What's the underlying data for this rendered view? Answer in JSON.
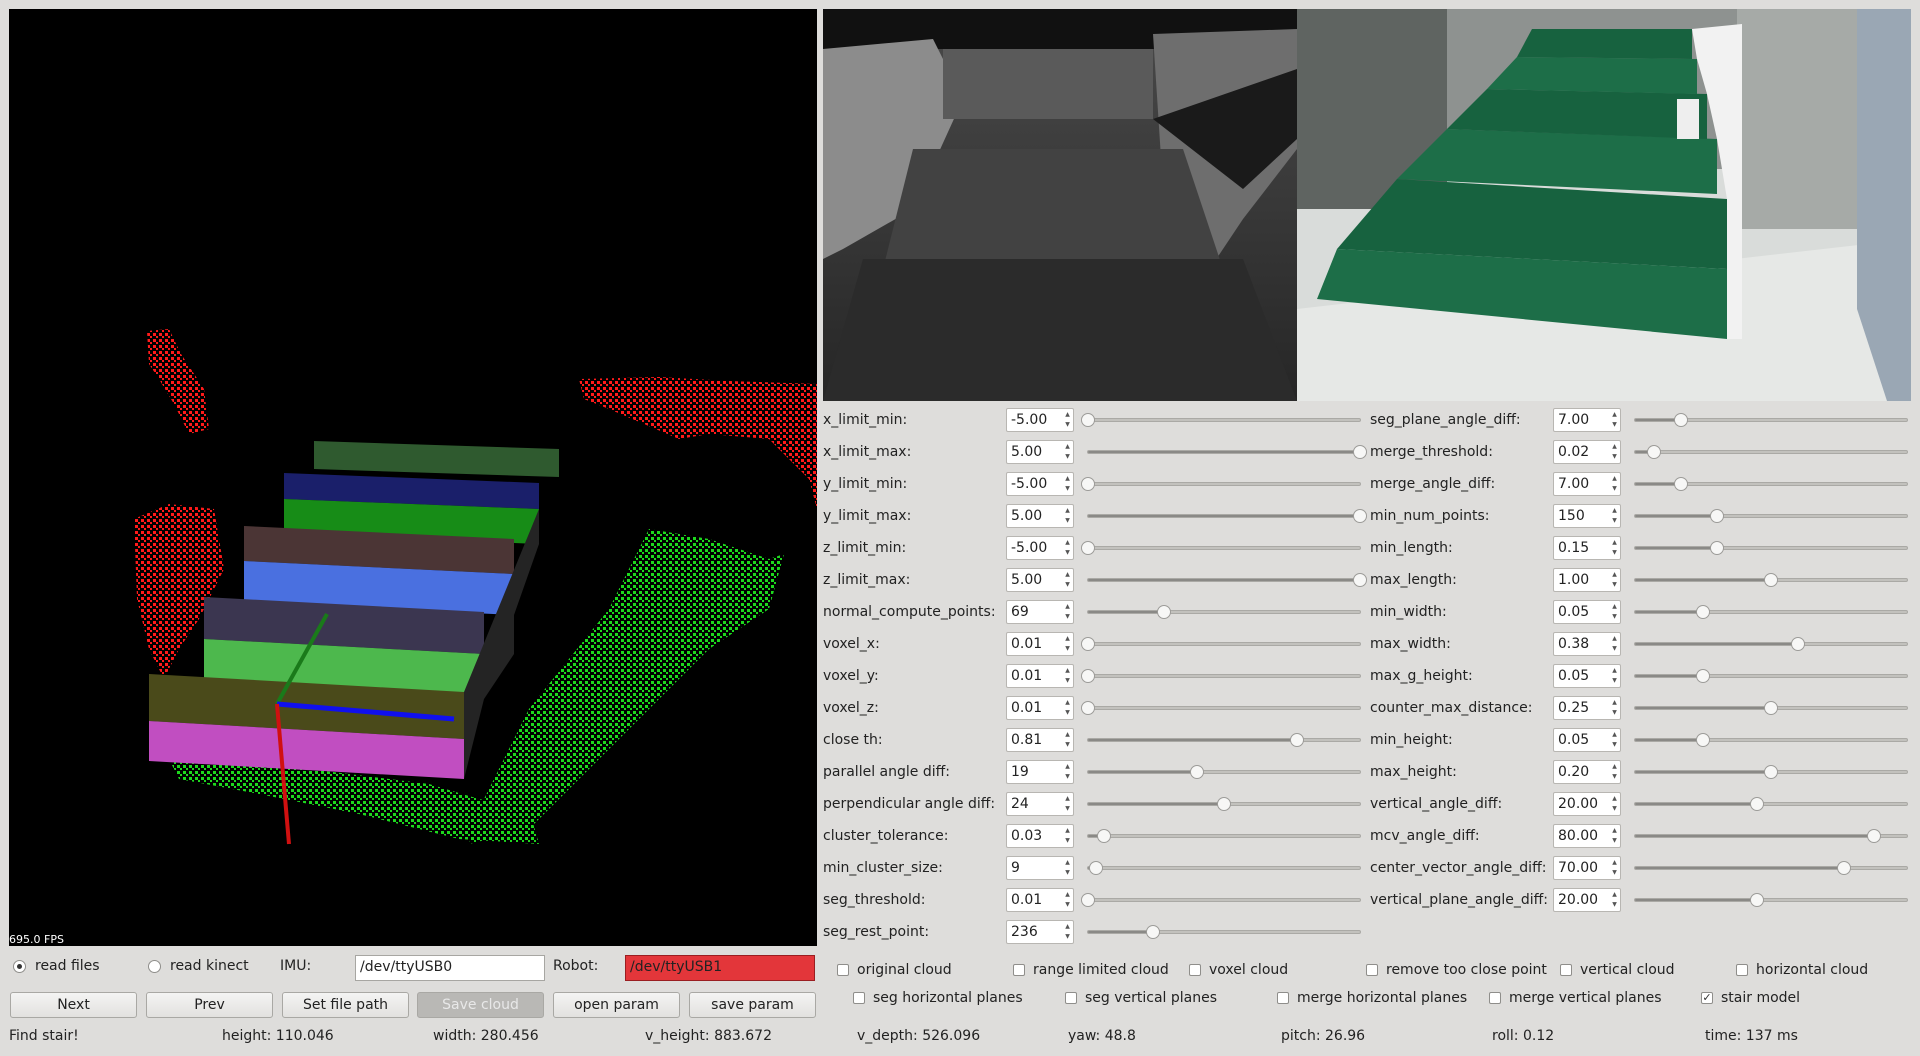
{
  "viewer": {
    "fps": "695.0 FPS"
  },
  "params_left": [
    {
      "label": "x_limit_min:",
      "value": "-5.00",
      "level": 0.0
    },
    {
      "label": "x_limit_max:",
      "value": "5.00",
      "level": 1.0
    },
    {
      "label": "y_limit_min:",
      "value": "-5.00",
      "level": 0.0
    },
    {
      "label": "y_limit_max:",
      "value": "5.00",
      "level": 1.0
    },
    {
      "label": "z_limit_min:",
      "value": "-5.00",
      "level": 0.0
    },
    {
      "label": "z_limit_max:",
      "value": "5.00",
      "level": 1.0
    },
    {
      "label": "normal_compute_points:",
      "value": "69",
      "level": 0.28
    },
    {
      "label": "voxel_x:",
      "value": "0.01",
      "level": 0.0
    },
    {
      "label": "voxel_y:",
      "value": "0.01",
      "level": 0.0
    },
    {
      "label": "voxel_z:",
      "value": "0.01",
      "level": 0.0
    },
    {
      "label": "close th:",
      "value": "0.81",
      "level": 0.77
    },
    {
      "label": "parallel angle diff:",
      "value": "19",
      "level": 0.4
    },
    {
      "label": "perpendicular angle diff:",
      "value": "24",
      "level": 0.5
    },
    {
      "label": "cluster_tolerance:",
      "value": "0.03",
      "level": 0.06
    },
    {
      "label": "min_cluster_size:",
      "value": "9",
      "level": 0.03
    },
    {
      "label": "seg_threshold:",
      "value": "0.01",
      "level": 0.0
    },
    {
      "label": "seg_rest_point:",
      "value": "236",
      "level": 0.24
    }
  ],
  "params_right": [
    {
      "label": "seg_plane_angle_diff:",
      "value": "7.00",
      "level": 0.17
    },
    {
      "label": "merge_threshold:",
      "value": "0.02",
      "level": 0.07
    },
    {
      "label": "merge_angle_diff:",
      "value": "7.00",
      "level": 0.17
    },
    {
      "label": "min_num_points:",
      "value": "150",
      "level": 0.3
    },
    {
      "label": "min_length:",
      "value": "0.15",
      "level": 0.3
    },
    {
      "label": "max_length:",
      "value": "1.00",
      "level": 0.5
    },
    {
      "label": "min_width:",
      "value": "0.05",
      "level": 0.25
    },
    {
      "label": "max_width:",
      "value": "0.38",
      "level": 0.6
    },
    {
      "label": "max_g_height:",
      "value": "0.05",
      "level": 0.25
    },
    {
      "label": "counter_max_distance:",
      "value": "0.25",
      "level": 0.5
    },
    {
      "label": "min_height:",
      "value": "0.05",
      "level": 0.25
    },
    {
      "label": "max_height:",
      "value": "0.20",
      "level": 0.5
    },
    {
      "label": "vertical_angle_diff:",
      "value": "20.00",
      "level": 0.45
    },
    {
      "label": "mcv_angle_diff:",
      "value": "80.00",
      "level": 0.88
    },
    {
      "label": "center_vector_angle_diff:",
      "value": "70.00",
      "level": 0.77
    },
    {
      "label": "vertical_plane_angle_diff:",
      "value": "20.00",
      "level": 0.45
    }
  ],
  "checkboxes_row1": [
    {
      "label": "original cloud",
      "checked": false
    },
    {
      "label": "range limited cloud",
      "checked": false
    },
    {
      "label": "voxel cloud",
      "checked": false
    },
    {
      "label": "remove too close point",
      "checked": false
    },
    {
      "label": "vertical cloud",
      "checked": false
    },
    {
      "label": "horizontal cloud",
      "checked": false
    }
  ],
  "checkboxes_row2": [
    {
      "label": "seg horizontal planes",
      "checked": false
    },
    {
      "label": "seg vertical planes",
      "checked": false
    },
    {
      "label": "merge horizontal planes",
      "checked": false
    },
    {
      "label": "merge vertical planes",
      "checked": false
    },
    {
      "label": "stair model",
      "checked": true
    }
  ],
  "controls": {
    "radio_read_files": "read files",
    "radio_read_kinect": "read kinect",
    "imu_label": "IMU:",
    "imu_value": "/dev/ttyUSB0",
    "robot_label": "Robot:",
    "robot_value": "/dev/ttyUSB1",
    "robot_field_color": "#e3363a"
  },
  "buttons": {
    "next": "Next",
    "prev": "Prev",
    "set_file_path": "Set file path",
    "save_cloud": "Save cloud",
    "open_param": "open param",
    "save_param": "save param"
  },
  "status": {
    "message": "Find stair!",
    "height": "height: 110.046",
    "width": "width: 280.456",
    "v_height": "v_height: 883.672",
    "v_depth": "v_depth: 526.096",
    "yaw": "yaw: 48.8",
    "pitch": "pitch: 26.96",
    "roll": "roll: 0.12",
    "time": "time: 137 ms"
  },
  "colors": {
    "cloud_red": "#ff1a1a",
    "cloud_green": "#1dd81d",
    "axis_x": "#1010ee",
    "axis_y": "#1a7a1a",
    "axis_z": "#d01010",
    "stair_carpet": "#1d6e48"
  }
}
